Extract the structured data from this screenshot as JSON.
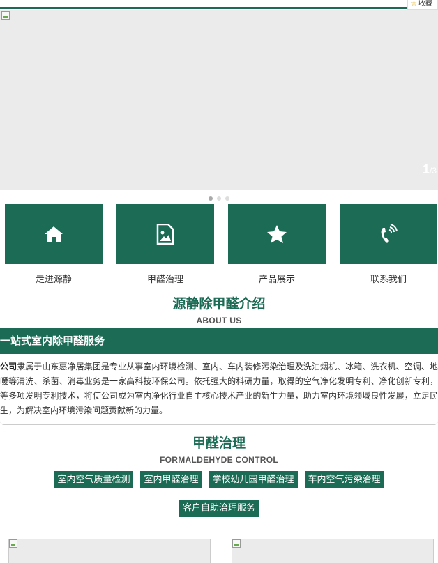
{
  "favorite": {
    "label": "收藏"
  },
  "banner": {
    "current": "1",
    "total": "/3"
  },
  "nav": [
    {
      "label": "走进源静",
      "icon": "home-icon"
    },
    {
      "label": "甲醛治理",
      "icon": "image-file-icon"
    },
    {
      "label": "产品展示",
      "icon": "star-icon"
    },
    {
      "label": "联系我们",
      "icon": "phone-icon"
    }
  ],
  "about": {
    "title": "源静除甲醛介绍",
    "subtitle": "ABOUT US",
    "bar_text": "一站式室内除甲醛服务",
    "company": "公司",
    "text": "隶属于山东惠净居集团是专业从事室内环境检测、室内、车内装修污染治理及洗油烟机、冰箱、洗衣机、空调、地暖等清洗、杀菌、消毒业务是一家高科技环保公司。依托强大的科研力量，取得的空气净化发明专利、净化创新专利，等多项发明专利技术，将使公司成为室内净化行业自主核心技术产业的新生力量，助力室内环境领域良性发展，立足民生，为解决室内环境污染问题贡献新的力量。"
  },
  "formaldehyde": {
    "title": "甲醛治理",
    "subtitle": "FORMALDEHYDE CONTROL",
    "tags_row1": [
      "室内空气质量检测",
      "室内甲醛治理",
      "学校幼儿园甲醛治理",
      "车内空气污染治理"
    ],
    "tags_row2": [
      "客户自助治理服务"
    ]
  },
  "colors": {
    "brand": "#1b6b55"
  }
}
